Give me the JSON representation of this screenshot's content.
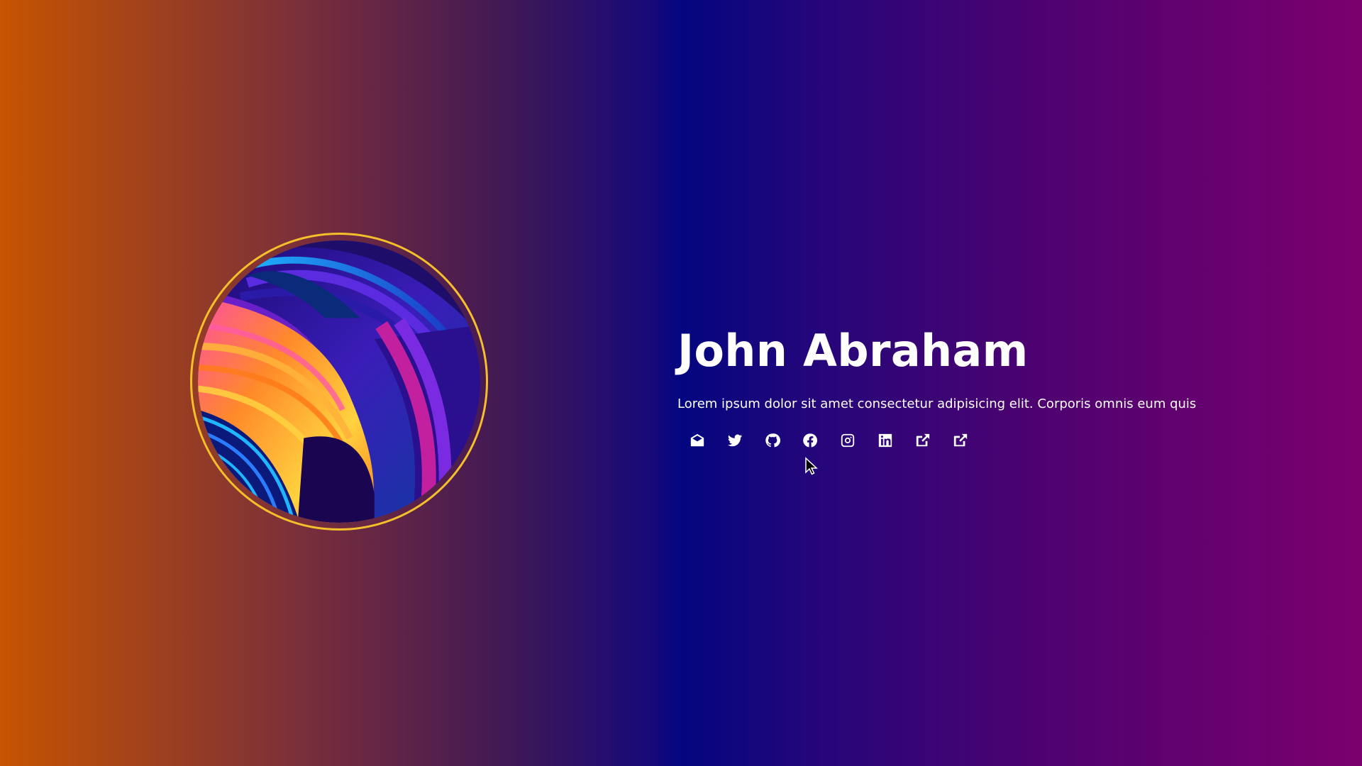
{
  "profile": {
    "name": "John Abraham",
    "bio": "Lorem ipsum dolor sit amet consectetur adipisicing elit. Corporis omnis eum quis"
  },
  "social_links": [
    {
      "icon": "mail-open-icon"
    },
    {
      "icon": "twitter-icon"
    },
    {
      "icon": "github-icon"
    },
    {
      "icon": "facebook-icon"
    },
    {
      "icon": "instagram-icon"
    },
    {
      "icon": "linkedin-icon"
    },
    {
      "icon": "external-link-icon"
    },
    {
      "icon": "external-link-icon"
    }
  ],
  "colors": {
    "avatar_ring": "#f4bf2a",
    "gradient_left": "#c65400",
    "gradient_middle": "#030680",
    "gradient_right": "#7b006e"
  }
}
